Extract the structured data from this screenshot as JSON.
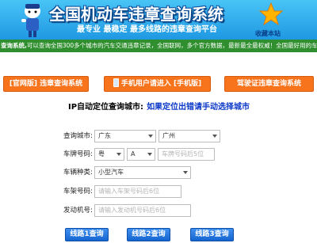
{
  "header": {
    "title": "全国机动车违章查询系统",
    "subtitle": "最专业 最稳定 最多线路的违章查询平台",
    "favorite_label": "收藏本站"
  },
  "notice": {
    "prefix": "查询系统,",
    "text": "可以查询全国300多个城市的汽车交通违章记录，全国联网，多个官方数据，最新最全最权威！全国最好用的车"
  },
  "nav_buttons": [
    {
      "label": "[官网版] 违章查询系统"
    },
    {
      "label": "手机用户请进入 [手机版]"
    },
    {
      "label": "驾驶证违章查询系统"
    }
  ],
  "ip_locate": {
    "label": "IP自动定位查询城市:",
    "link": "如果定位出错请手动选择城市"
  },
  "form": {
    "city_label": "查询城市:",
    "province": "广东",
    "city": "广州",
    "plate_label": "车牌号码:",
    "plate_prefix": "粤",
    "plate_letter": "A",
    "plate_placeholder": "车牌号码后5位",
    "type_label": "车辆种类:",
    "vehicle_type": "小型汽车",
    "frame_label": "车架号码:",
    "frame_placeholder": "请输入车架号码后6位",
    "engine_label": "发动机号:",
    "engine_placeholder": "请输入发动机号码后6位"
  },
  "query_buttons": [
    {
      "label": "线路1查询"
    },
    {
      "label": "线路2查询"
    },
    {
      "label": "线路3查询"
    }
  ],
  "colors": {
    "header_blue": "#1f98e2",
    "notice_green": "#2f8f2f",
    "orange": "#f7731c",
    "button_blue": "#1565d1",
    "link_blue": "#0a37c8"
  }
}
